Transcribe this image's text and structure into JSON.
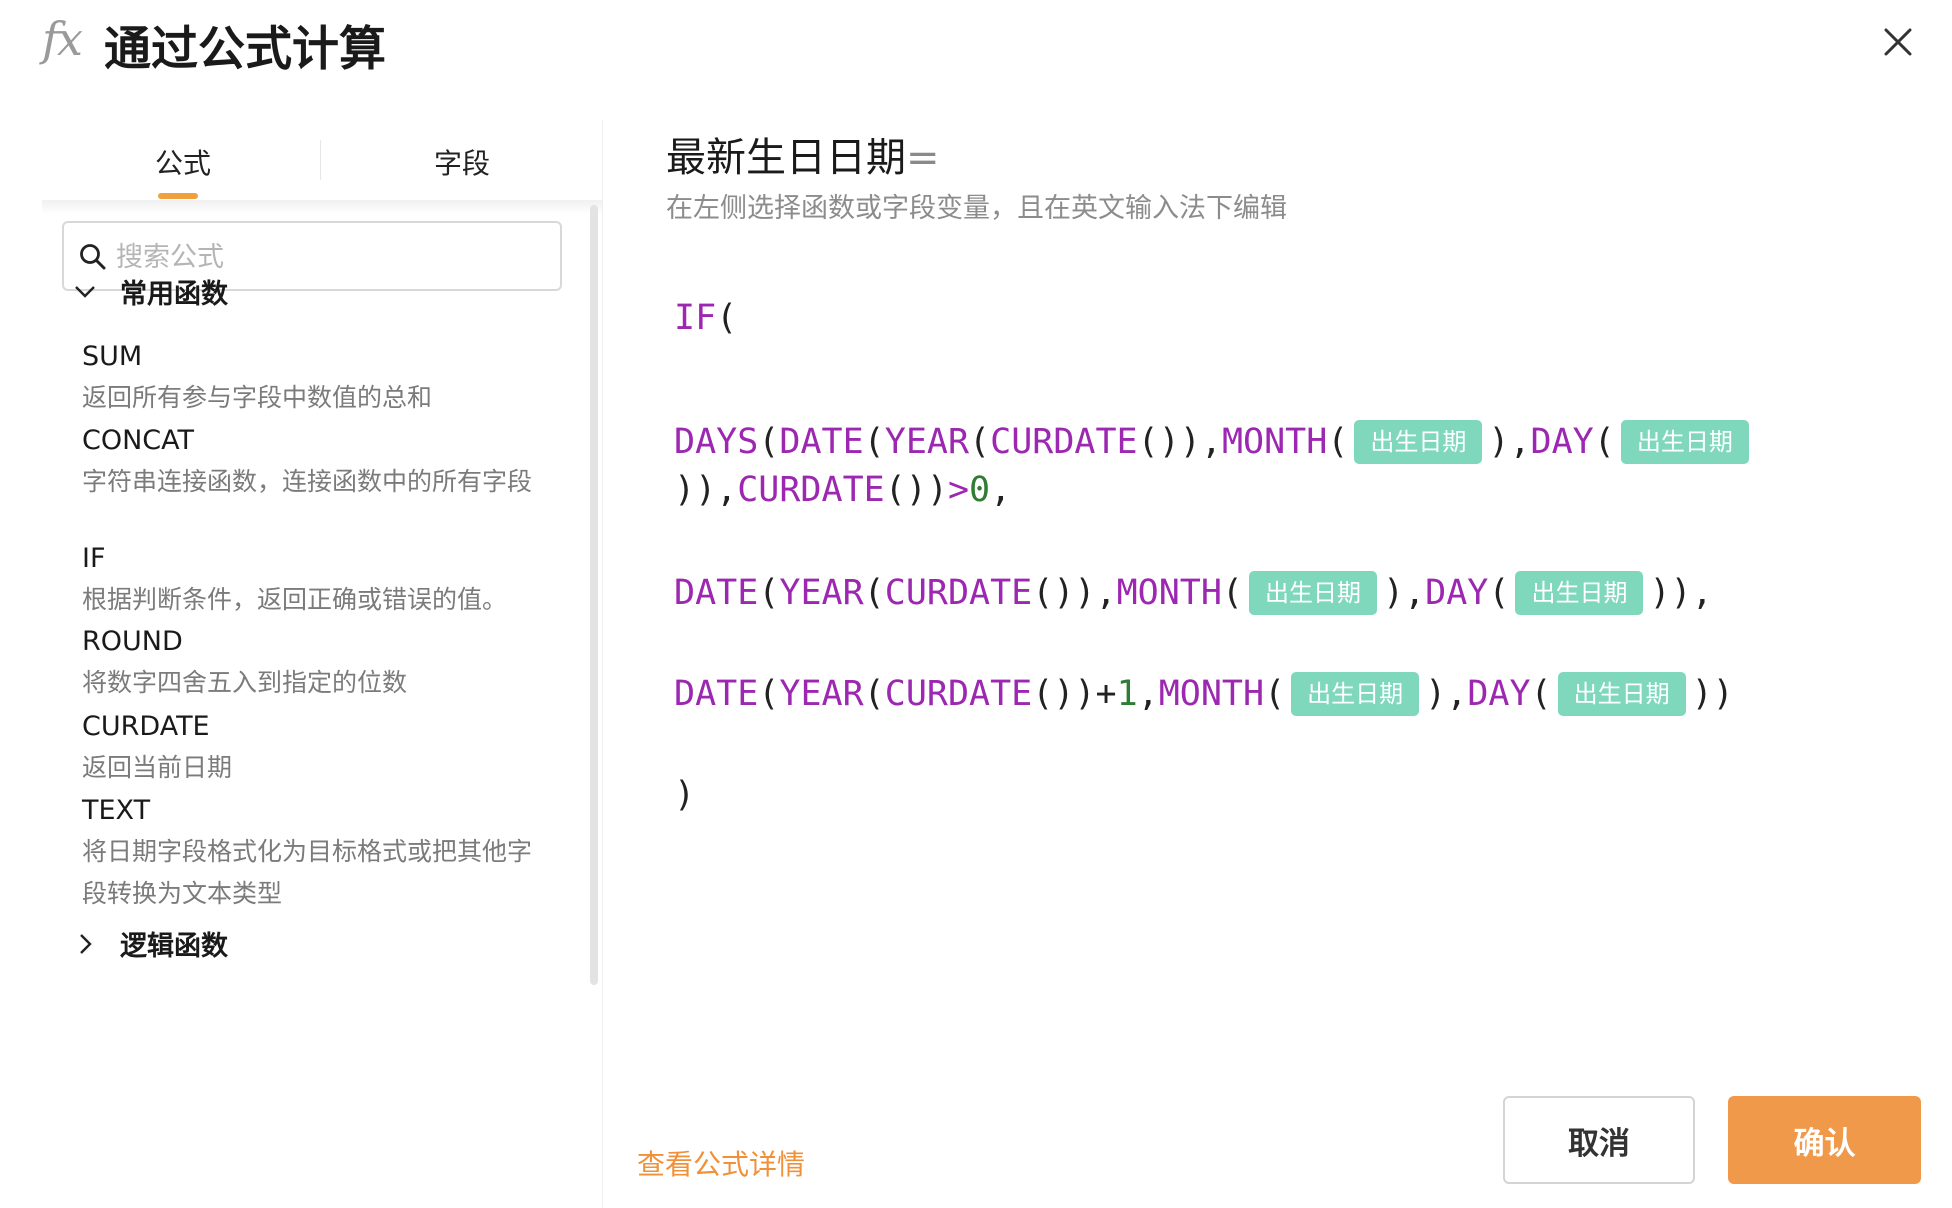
{
  "dialog": {
    "fx_icon": "fx",
    "title": "通过公式计算",
    "close_icon": "close-icon"
  },
  "tabs": [
    {
      "label": "公式",
      "active": true
    },
    {
      "label": "字段",
      "active": false
    }
  ],
  "search": {
    "placeholder": "搜索公式",
    "value": ""
  },
  "groups": [
    {
      "label": "常用函数",
      "expanded": true,
      "functions": [
        {
          "name": "SUM",
          "description": "返回所有参与字段中数值的总和"
        },
        {
          "name": "CONCAT",
          "description": "字符串连接函数，连接函数中的所有字段"
        },
        {
          "name": "IF",
          "description": "根据判断条件，返回正确或错误的值。"
        },
        {
          "name": "ROUND",
          "description": "将数字四舍五入到指定的位数"
        },
        {
          "name": "CURDATE",
          "description": "返回当前日期"
        },
        {
          "name": "TEXT",
          "description": "将日期字段格式化为目标格式或把其他字段转换为文本类型"
        }
      ]
    },
    {
      "label": "逻辑函数",
      "expanded": false
    }
  ],
  "editor": {
    "field_name": "最新生日日期",
    "equals": "=",
    "hint": "在左侧选择函数或字段变量，且在英文输入法下编辑",
    "field_chip": "出生日期"
  },
  "footer": {
    "details_link": "查看公式详情",
    "cancel_label": "取消",
    "confirm_label": "确认"
  },
  "colors": {
    "accent": "#f0994b",
    "function": "#9c27b0",
    "number": "#2e7d32",
    "chip": "#7fd8bb"
  }
}
